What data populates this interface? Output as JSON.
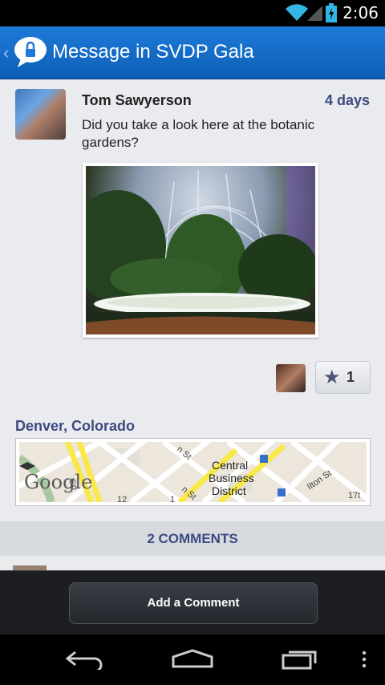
{
  "status_bar": {
    "time": "2:06"
  },
  "app_bar": {
    "title": "Message in SVDP Gala"
  },
  "post": {
    "author": "Tom Sawyerson",
    "age": "4 days",
    "text": "Did you take a look here at the botanic gardens?",
    "likes_count": "1",
    "location": "Denver, Colorado"
  },
  "map": {
    "watermark": "Google",
    "district_line1": "Central",
    "district_line2": "Business",
    "district_line3": "District",
    "street_labels": [
      "n St",
      "n St",
      "Ilton St",
      "17t",
      "12",
      "1",
      "Sp"
    ]
  },
  "comments": {
    "header": "2 COMMENTS"
  },
  "bottom": {
    "add_comment": "Add a Comment"
  },
  "colors": {
    "accent": "#0d5fb7",
    "label": "#3d4a80"
  },
  "icons": [
    "wifi-icon",
    "signal-icon",
    "battery-icon",
    "chat-lock-icon",
    "star-icon",
    "back-nav-icon",
    "home-nav-icon",
    "recents-nav-icon",
    "menu-dots-icon"
  ]
}
